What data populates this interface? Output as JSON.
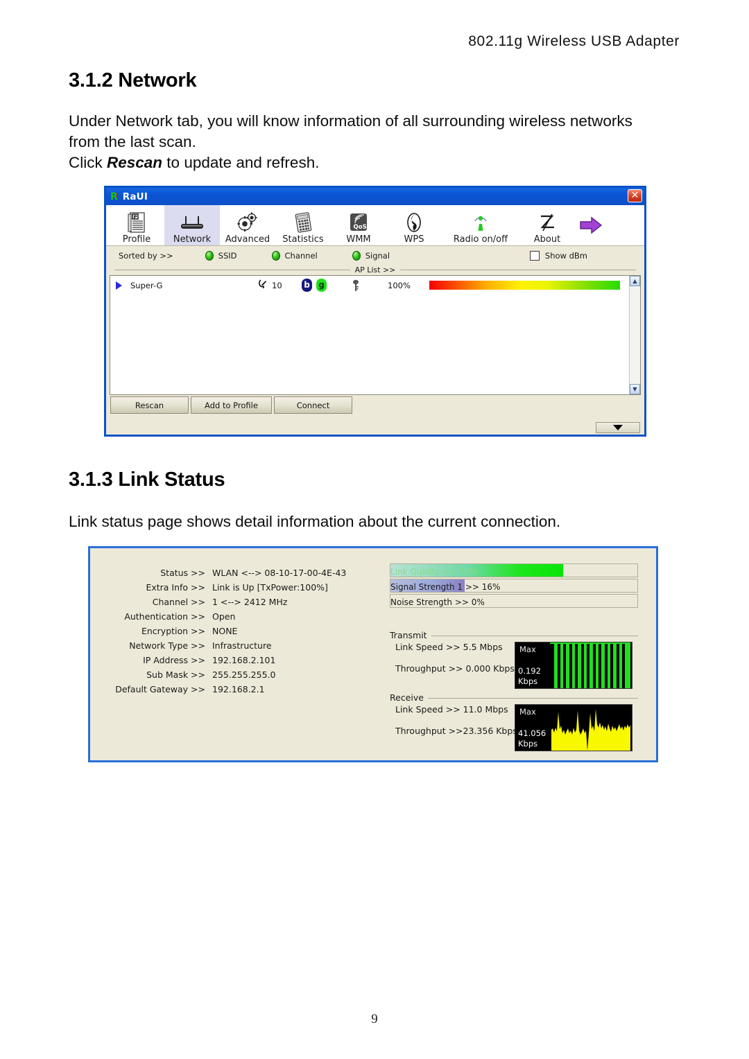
{
  "document": {
    "header": "802.11g Wireless USB Adapter",
    "page_number": "9"
  },
  "sections": {
    "network": {
      "heading": "3.1.2 Network",
      "paragraph_1": "Under Network tab, you will know information of all surrounding wireless networks from the last scan.",
      "paragraph_2_prefix": "Click ",
      "paragraph_2_emphasis": "Rescan",
      "paragraph_2_suffix": " to update and refresh."
    },
    "link_status": {
      "heading": "3.1.3 Link Status",
      "paragraph": "Link status page shows detail information about the current connection."
    }
  },
  "raui_window": {
    "title": "RaUI",
    "logo_text": "R",
    "close_label": "✕",
    "toolbar": [
      {
        "label": "Profile",
        "icon": "profile-page-icon",
        "active": false
      },
      {
        "label": "Network",
        "icon": "router-icon",
        "active": true
      },
      {
        "label": "Advanced",
        "icon": "gears-icon",
        "active": false
      },
      {
        "label": "Statistics",
        "icon": "calculator-icon",
        "active": false
      },
      {
        "label": "WMM",
        "icon": "qos-icon",
        "active": false
      },
      {
        "label": "WPS",
        "icon": "wps-icon",
        "active": false
      },
      {
        "label": "Radio on/off",
        "icon": "antenna-icon",
        "active": false
      },
      {
        "label": "About",
        "icon": "signature-icon",
        "active": false
      }
    ],
    "toolbar_arrow_icon": "purple-right-arrow-icon",
    "sortbar": {
      "sorted_by_label": "Sorted by >>",
      "options": [
        "SSID",
        "Channel",
        "Signal"
      ],
      "show_dbm_label": "Show dBm",
      "show_dbm_checked": false
    },
    "ap_list": {
      "caption": "AP List >>",
      "rows": [
        {
          "ssid": "Super-G",
          "channel": "10",
          "badges": [
            "b",
            "g"
          ],
          "security": "key-icon",
          "signal_percent": "100%",
          "signal_value": 100
        }
      ]
    },
    "buttons": [
      {
        "id": "rescan",
        "label": "Rescan"
      },
      {
        "id": "add-to-profile",
        "label": "Add to Profile"
      },
      {
        "id": "connect",
        "label": "Connect"
      }
    ],
    "colors": {
      "titlebar": "#0a55d6",
      "window_bg": "#ece9d8",
      "active_tab": "#dcdcf0",
      "close_button": "#d9482b",
      "selection_marker": "#2a2ad0",
      "badge_b": "#17197f",
      "badge_g": "#1ee01e"
    }
  },
  "link_status_panel": {
    "fields": [
      {
        "label": "Status >>",
        "value": "WLAN     <--> 08-10-17-00-4E-43"
      },
      {
        "label": "Extra Info >>",
        "value": "Link is Up [TxPower:100%]"
      },
      {
        "label": "Channel >>",
        "value": "1 <--> 2412 MHz"
      },
      {
        "label": "Authentication >>",
        "value": "Open"
      },
      {
        "label": "Encryption >>",
        "value": "NONE"
      },
      {
        "label": "Network Type >>",
        "value": "Infrastructure"
      },
      {
        "label": "IP Address >>",
        "value": "192.168.2.101"
      },
      {
        "label": "Sub Mask >>",
        "value": "255.255.255.0"
      },
      {
        "label": "Default Gateway >>",
        "value": "192.168.2.1"
      }
    ],
    "quality_bars": [
      {
        "id": "link-quality",
        "text": "Link Quality >> 70%",
        "percent": 70
      },
      {
        "id": "signal-strength",
        "text": "Signal Strength 1 >> 16%",
        "percent": 30
      },
      {
        "id": "noise-strength",
        "text": "Noise Strength >> 0%",
        "percent": 0
      }
    ],
    "transmit": {
      "title": "Transmit",
      "link_speed": "Link Speed >>  5.5 Mbps",
      "throughput": "Throughput >> 0.000 Kbps",
      "graph_max_label": "Max",
      "graph_value": "0.192",
      "graph_unit": "Kbps",
      "graph_color": "#1ee01e"
    },
    "receive": {
      "title": "Receive",
      "link_speed": "Link Speed >> 11.0 Mbps",
      "throughput": "Throughput >>23.356 Kbps",
      "graph_max_label": "Max",
      "graph_value": "41.056",
      "graph_unit": "Kbps",
      "graph_color": "#f8f800"
    },
    "colors": {
      "border": "#2a6fd8",
      "background": "#ece9d8",
      "link_quality_fill": "#1de61d",
      "signal_fill": "#8d7fc4",
      "graph_bg": "#000000"
    }
  }
}
